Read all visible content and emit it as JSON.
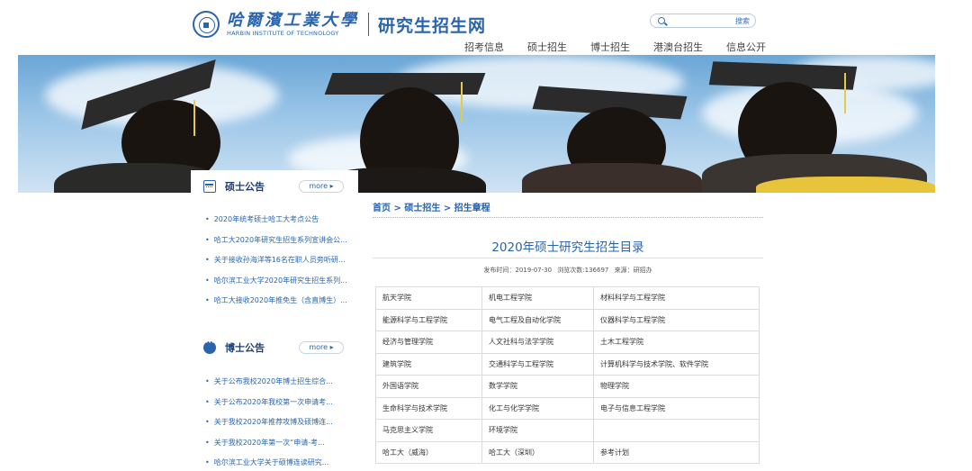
{
  "header": {
    "logo_cn": "哈爾濱工業大學",
    "logo_en": "HARBIN INSTITUTE OF TECHNOLOGY",
    "site_title": "研究生招生网",
    "search": {
      "placeholder": "",
      "button": "搜索"
    },
    "nav": [
      "招考信息",
      "硕士招生",
      "博士招生",
      "港澳台招生",
      "信息公开"
    ]
  },
  "sidebar": {
    "master": {
      "title": "硕士公告",
      "more": "more ▸",
      "items": [
        "2020年统考硕士哈工大考点公告",
        "哈工大2020年研究生招生系列宣讲会公...",
        "关于接收孙海洋等16名在职人员旁听研...",
        "哈尔滨工业大学2020年研究生招生系列...",
        "哈工大接收2020年推免生（含直博生）..."
      ]
    },
    "phd": {
      "title": "博士公告",
      "more": "more ▸",
      "items": [
        "关于公布我校2020年博士招生综合...",
        "关于公布2020年我校第一次申请考...",
        "关于我校2020年推荐攻博及硕博连...",
        "关于我校2020年第一次“申请-考...",
        "哈尔滨工业大学关于硕博连读研究..."
      ]
    }
  },
  "main": {
    "breadcrumb": "首页 > 硕士招生 > 招生章程",
    "title": "2020年硕士研究生招生目录",
    "meta": {
      "published": "发布时间：2019-07-30",
      "views": "浏览次数:136697",
      "source": "来源：研招办"
    },
    "table": [
      [
        "航天学院",
        "机电工程学院",
        "材料科学与工程学院"
      ],
      [
        "能源科学与工程学院",
        "电气工程及自动化学院",
        "仪器科学与工程学院"
      ],
      [
        "经济与管理学院",
        "人文社科与法学学院",
        "土木工程学院"
      ],
      [
        "建筑学院",
        "交通科学与工程学院",
        "计算机科学与技术学院、软件学院"
      ],
      [
        "外国语学院",
        "数学学院",
        "物理学院"
      ],
      [
        "生命科学与技术学院",
        "化工与化学学院",
        "电子与信息工程学院"
      ],
      [
        "马克思主义学院",
        "环境学院",
        ""
      ],
      [
        "哈工大（威海）",
        "哈工大（深圳）",
        "参考计划"
      ]
    ]
  },
  "colors": {
    "brand_blue": "#2a64ad",
    "text": "#333333",
    "border": "#dcdcdc"
  },
  "icons": {
    "search": "search-icon",
    "master_section": "calendar-icon",
    "phd_section": "chat-bubble-icon",
    "logo": "university-seal-logo"
  }
}
